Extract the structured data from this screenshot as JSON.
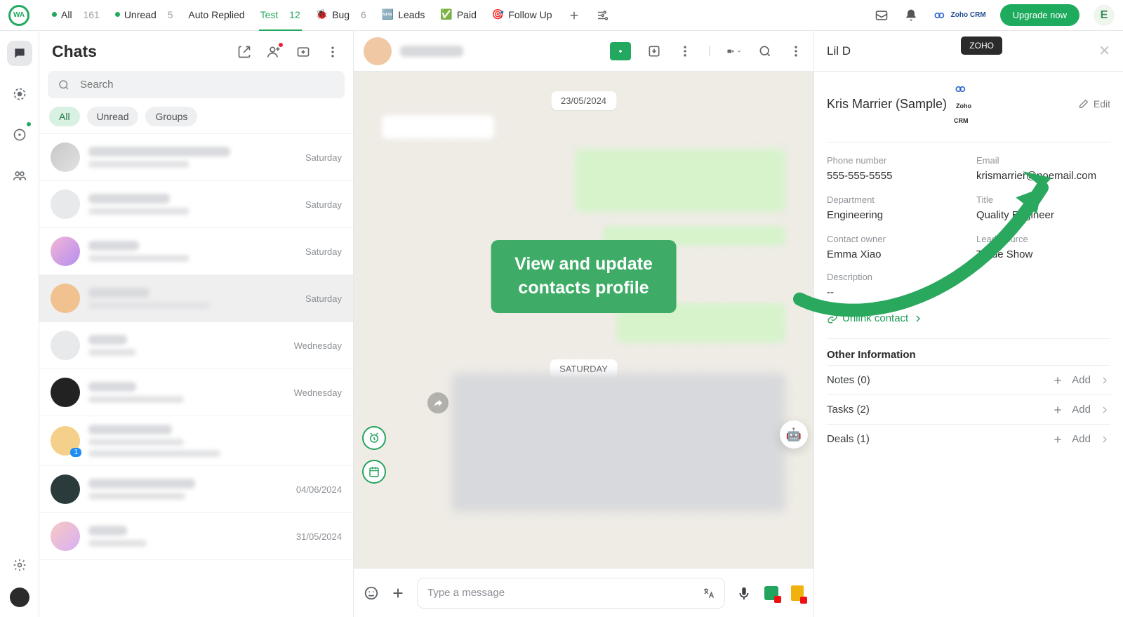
{
  "topbar": {
    "tabs": [
      {
        "label": "All",
        "count": "161",
        "color": "#22a95f"
      },
      {
        "label": "Unread",
        "count": "5",
        "color": "#22a95f"
      },
      {
        "label": "Auto Replied",
        "count": "",
        "color": "transparent"
      },
      {
        "label": "Test",
        "count": "12",
        "color": "transparent",
        "active": true
      },
      {
        "label": "Bug",
        "count": "6",
        "color": "transparent",
        "emoji": "🐞"
      },
      {
        "label": "Leads",
        "count": "",
        "color": "transparent",
        "emoji": "🆕"
      },
      {
        "label": "Paid",
        "count": "",
        "color": "transparent",
        "emoji": "✅"
      },
      {
        "label": "Follow Up",
        "count": "",
        "color": "transparent",
        "emoji": "🎯"
      }
    ],
    "crm_label": "Zoho CRM",
    "upgrade": "Upgrade now",
    "avatar": "E",
    "tooltip": "ZOHO"
  },
  "chats": {
    "title": "Chats",
    "search_placeholder": "Search",
    "chips": [
      {
        "label": "All",
        "active": true
      },
      {
        "label": "Unread"
      },
      {
        "label": "Groups"
      }
    ],
    "items": [
      {
        "when": "Saturday"
      },
      {
        "when": "Saturday"
      },
      {
        "when": "Saturday"
      },
      {
        "when": "Saturday",
        "selected": true
      },
      {
        "when": "Wednesday"
      },
      {
        "when": "Wednesday"
      },
      {
        "when": "",
        "badge": "1"
      },
      {
        "when": "04/06/2024"
      },
      {
        "when": "31/05/2024"
      }
    ]
  },
  "conversation": {
    "date1": "23/05/2024",
    "date2": "SATURDAY",
    "callout_line1": "View and update",
    "callout_line2": "contacts profile",
    "composer_placeholder": "Type a message"
  },
  "crm": {
    "panel_title": "Lil D",
    "contact_name": "Kris Marrier (Sample)",
    "edit": "Edit",
    "fields": {
      "phone_label": "Phone number",
      "phone": "555-555-5555",
      "email_label": "Email",
      "email": "krismarrier@noemail.com",
      "dept_label": "Department",
      "dept": "Engineering",
      "title_label": "Title",
      "title_val": "Quality Engineer",
      "owner_label": "Contact owner",
      "owner": "Emma Xiao",
      "source_label": "Lead Source",
      "source": "Trade Show",
      "desc_label": "Description",
      "desc": "--"
    },
    "unlink": "Unlink contact",
    "other_info": "Other Information",
    "rows": [
      {
        "label": "Notes (0)",
        "add": "Add"
      },
      {
        "label": "Tasks (2)",
        "add": "Add"
      },
      {
        "label": "Deals (1)",
        "add": "Add"
      }
    ]
  }
}
